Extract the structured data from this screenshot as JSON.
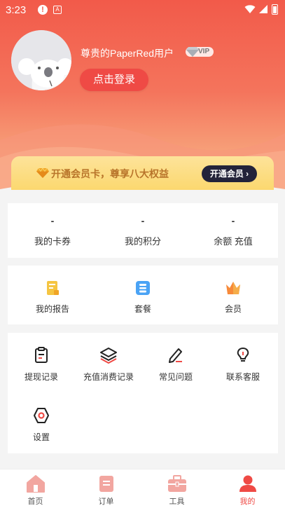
{
  "status_bar": {
    "time": "3:23"
  },
  "profile": {
    "user_name": "尊贵的PaperRed用户",
    "vip_label": "VIP",
    "login_label": "点击登录"
  },
  "member_banner": {
    "text": "开通会员卡，尊享八大权益",
    "button_label": "开通会员",
    "button_arrow": "›"
  },
  "stats": [
    {
      "value": "-",
      "label": "我的卡券"
    },
    {
      "value": "-",
      "label": "我的积分"
    },
    {
      "value": "-",
      "label": "余额 充值"
    }
  ],
  "services": [
    {
      "label": "我的报告",
      "icon": "report-icon"
    },
    {
      "label": "套餐",
      "icon": "package-icon"
    },
    {
      "label": "会员",
      "icon": "crown-icon"
    }
  ],
  "tools": [
    {
      "label": "提现记录",
      "icon": "clipboard-icon"
    },
    {
      "label": "充值消费记录",
      "icon": "layers-icon"
    },
    {
      "label": "常见问题",
      "icon": "pencil-icon"
    },
    {
      "label": "联系客服",
      "icon": "lightbulb-icon"
    },
    {
      "label": "设置",
      "icon": "settings-hexagon-icon"
    }
  ],
  "tabbar": [
    {
      "label": "首页",
      "icon": "home-icon",
      "active": false
    },
    {
      "label": "订单",
      "icon": "order-icon",
      "active": false
    },
    {
      "label": "工具",
      "icon": "toolbox-icon",
      "active": false
    },
    {
      "label": "我的",
      "icon": "user-icon",
      "active": true
    }
  ],
  "colors": {
    "accent": "#ef4a45",
    "header_top": "#f25a4a",
    "banner_gold": "#fcd86f",
    "banner_text": "#b8742a",
    "dark_button": "#23233a",
    "tab_inactive_icon": "#f2a6a0"
  }
}
